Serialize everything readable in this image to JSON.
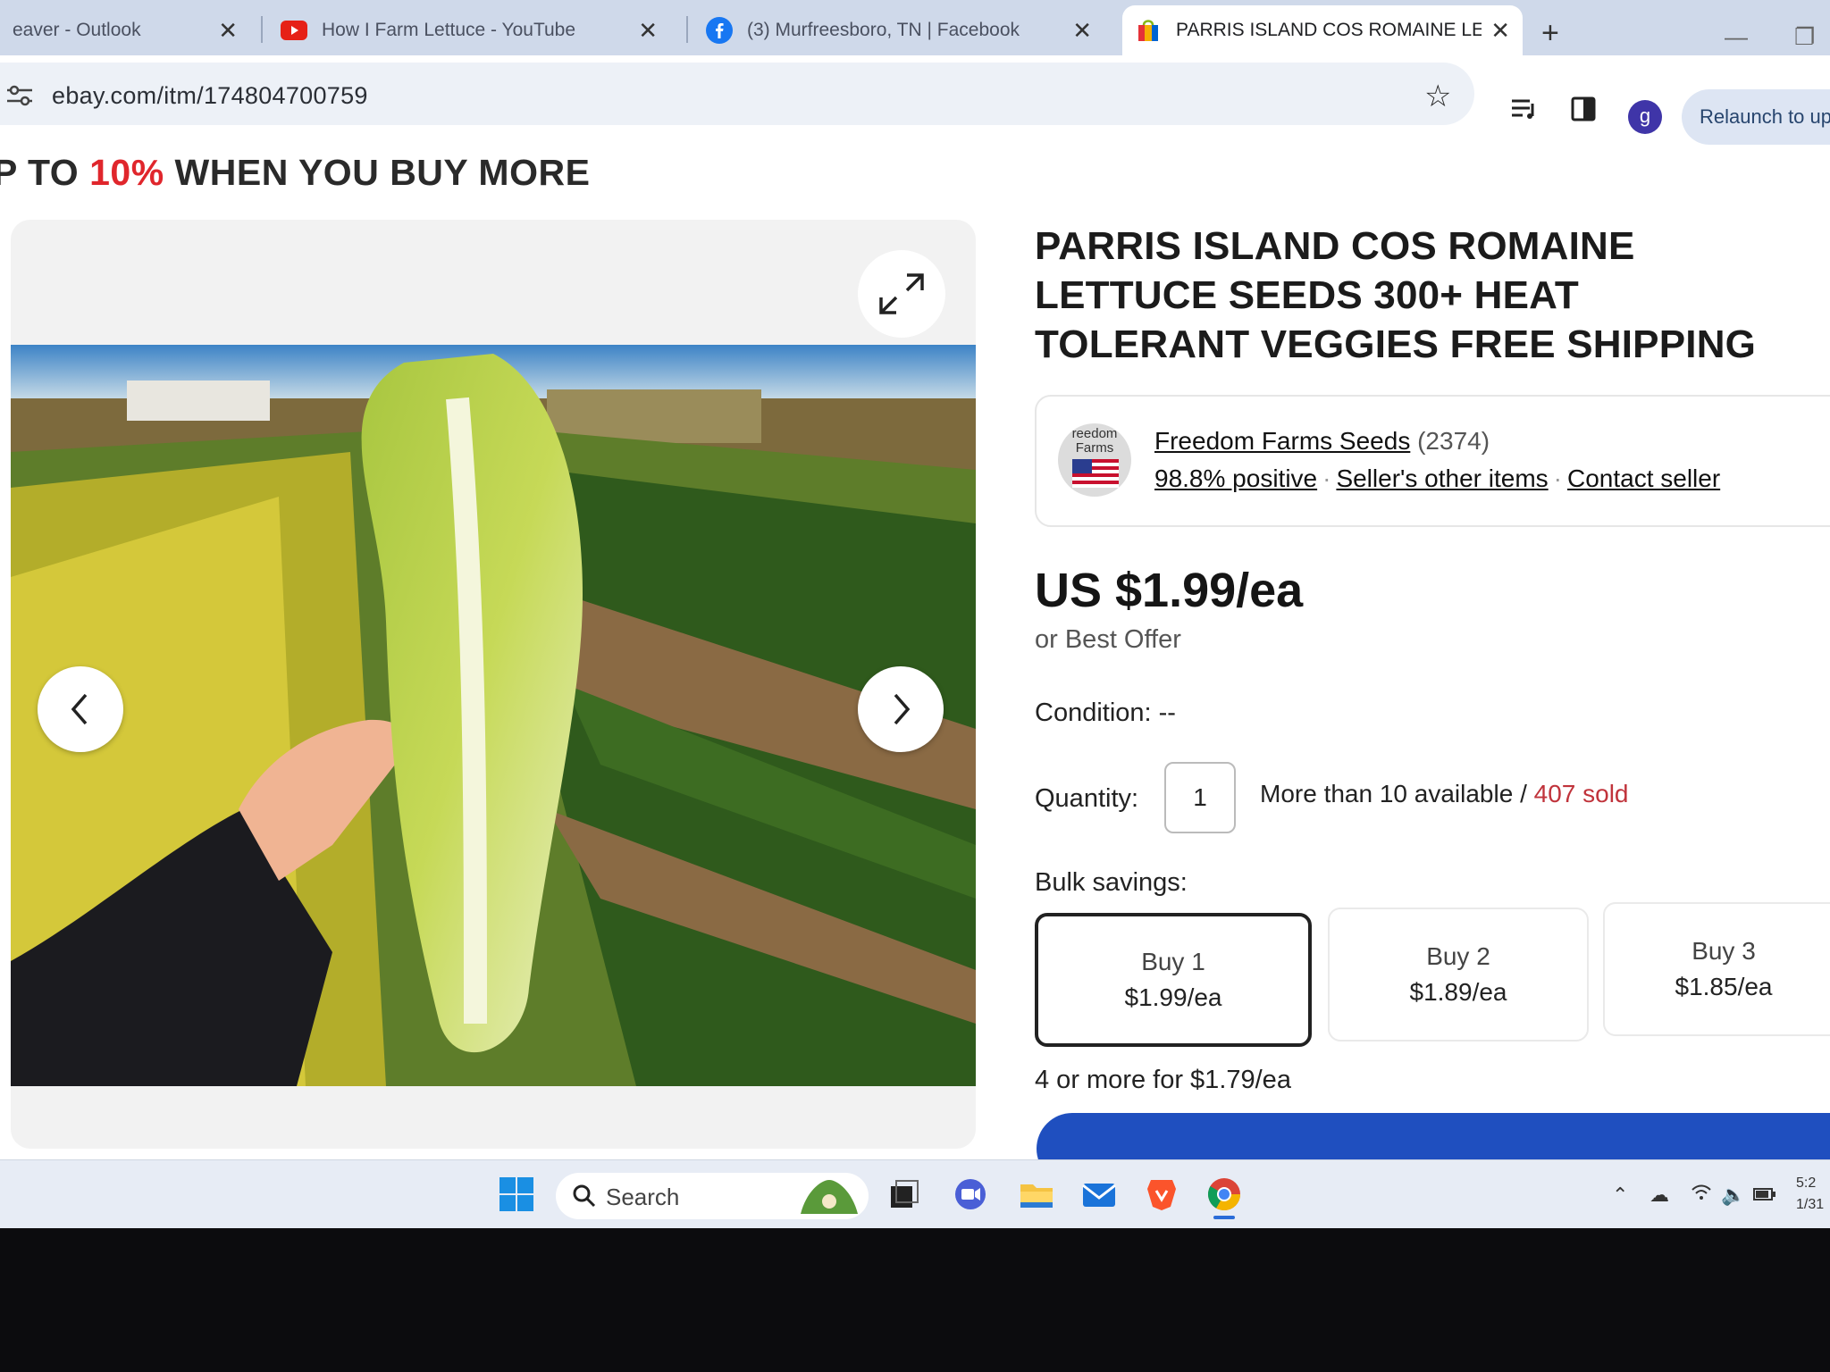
{
  "browser": {
    "tabs": [
      {
        "title": "eaver - Outlook",
        "icon": "outlook-icon",
        "active": false
      },
      {
        "title": "How I Farm Lettuce - YouTube",
        "icon": "youtube-icon",
        "active": false
      },
      {
        "title": "(3) Murfreesboro, TN | Facebook",
        "icon": "facebook-icon",
        "active": false
      },
      {
        "title": "PARRIS ISLAND COS ROMAINE LETTU",
        "icon": "ebay-icon",
        "active": true
      }
    ],
    "new_tab_label": "+",
    "url": "ebay.com/itm/174804700759",
    "profile_initial": "g",
    "relaunch_label": "Relaunch to up"
  },
  "promo": {
    "prefix": "P TO ",
    "highlight": "10%",
    "suffix": " WHEN YOU BUY MORE"
  },
  "listing": {
    "title": "PARRIS ISLAND COS ROMAINE LETTUCE SEEDS 300+ HEAT TOLERANT VEGGIES FREE SHIPPING",
    "seller": {
      "logo_text": "reedom Farms",
      "name": "Freedom Farms Seeds",
      "feedback_count": "(2374)",
      "positive": "98.8% positive",
      "other_items": "Seller's other items",
      "contact": "Contact seller"
    },
    "price": "US $1.99/ea",
    "best_offer": "or Best Offer",
    "condition": "Condition:  --",
    "quantity_label": "Quantity:",
    "quantity_value": "1",
    "availability": "More than 10 available / ",
    "sold": "407 sold",
    "bulk_label": "Bulk savings:",
    "bulk_options": [
      {
        "label": "Buy 1",
        "price": "$1.99/ea",
        "selected": true
      },
      {
        "label": "Buy 2",
        "price": "$1.89/ea",
        "selected": false
      },
      {
        "label": "Buy 3",
        "price": "$1.85/ea",
        "selected": false
      }
    ],
    "bulk_more": "4 or more for $1.79/ea"
  },
  "taskbar": {
    "search_label": "Search",
    "clock_time": "5:2",
    "clock_date": "1/31"
  },
  "colors": {
    "promo_red": "#e0262c",
    "sold_red": "#c0333b",
    "buy_button_blue": "#1f4fbf"
  }
}
